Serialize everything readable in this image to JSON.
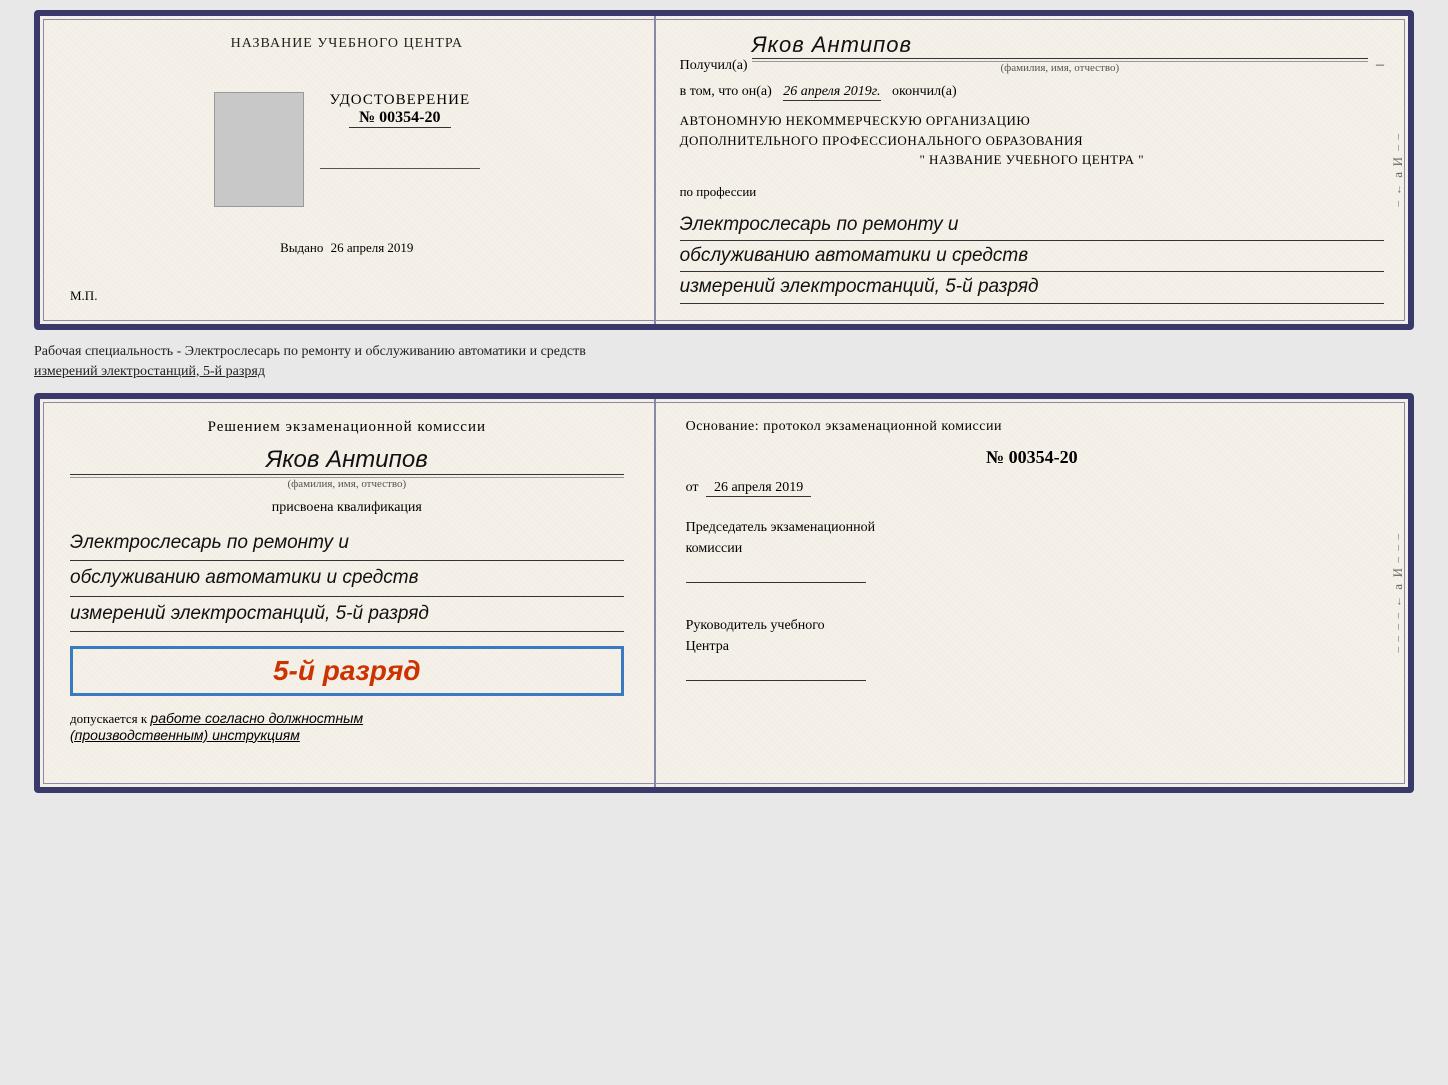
{
  "top_card": {
    "left": {
      "title": "НАЗВАНИЕ УЧЕБНОГО ЦЕНТРА",
      "udostoverenie_label": "УДОСТОВЕРЕНИЕ",
      "number": "№ 00354-20",
      "vydano_label": "Выдано",
      "vydano_date": "26 апреля 2019",
      "mp": "М.П."
    },
    "right": {
      "poluchil_label": "Получил(а)",
      "recipient_name": "Яков Антипов",
      "fio_hint": "(фамилия, имя, отчество)",
      "vtom_label": "в том, что он(а)",
      "vtom_date": "26 апреля 2019г.",
      "okonchil": "окончил(а)",
      "org_line1": "АВТОНОМНУЮ НЕКОММЕРЧЕСКУЮ ОРГАНИЗАЦИЮ",
      "org_line2": "ДОПОЛНИТЕЛЬНОГО ПРОФЕССИОНАЛЬНОГО ОБРАЗОВАНИЯ",
      "org_name": "\" НАЗВАНИЕ УЧЕБНОГО ЦЕНТРА \"",
      "po_professii": "по профессии",
      "profession_line1": "Электрослесарь по ремонту и",
      "profession_line2": "обслуживанию автоматики и средств",
      "profession_line3": "измерений электростанций, 5-й разряд"
    }
  },
  "middle": {
    "text_line1": "Рабочая специальность - Электрослесарь по ремонту и обслуживанию автоматики и средств",
    "text_line2": "измерений электростанций, 5-й разряд"
  },
  "bottom_card": {
    "left": {
      "komissia_header": "Решением экзаменационной комиссии",
      "person_name": "Яков Антипов",
      "fio_hint": "(фамилия, имя, отчество)",
      "prisvoena": "присвоена квалификация",
      "qual_line1": "Электрослесарь по ремонту и",
      "qual_line2": "обслуживанию автоматики и средств",
      "qual_line3": "измерений электростанций, 5-й разряд",
      "razryad_box": "5-й разряд",
      "dopuskaetsya_prefix": "допускается к",
      "dopuskaetsya_text": "работе согласно должностным",
      "dopuskaetsya_text2": "(производственным) инструкциям"
    },
    "right": {
      "osnovanie_label": "Основание: протокол экзаменационной комиссии",
      "protocol_number": "№ 00354-20",
      "ot_label": "от",
      "protocol_date": "26 апреля 2019",
      "predsedatel_line1": "Председатель экзаменационной",
      "predsedatel_line2": "комиссии",
      "rukovoditel_line1": "Руководитель учебного",
      "rukovoditel_line2": "Центра"
    }
  }
}
